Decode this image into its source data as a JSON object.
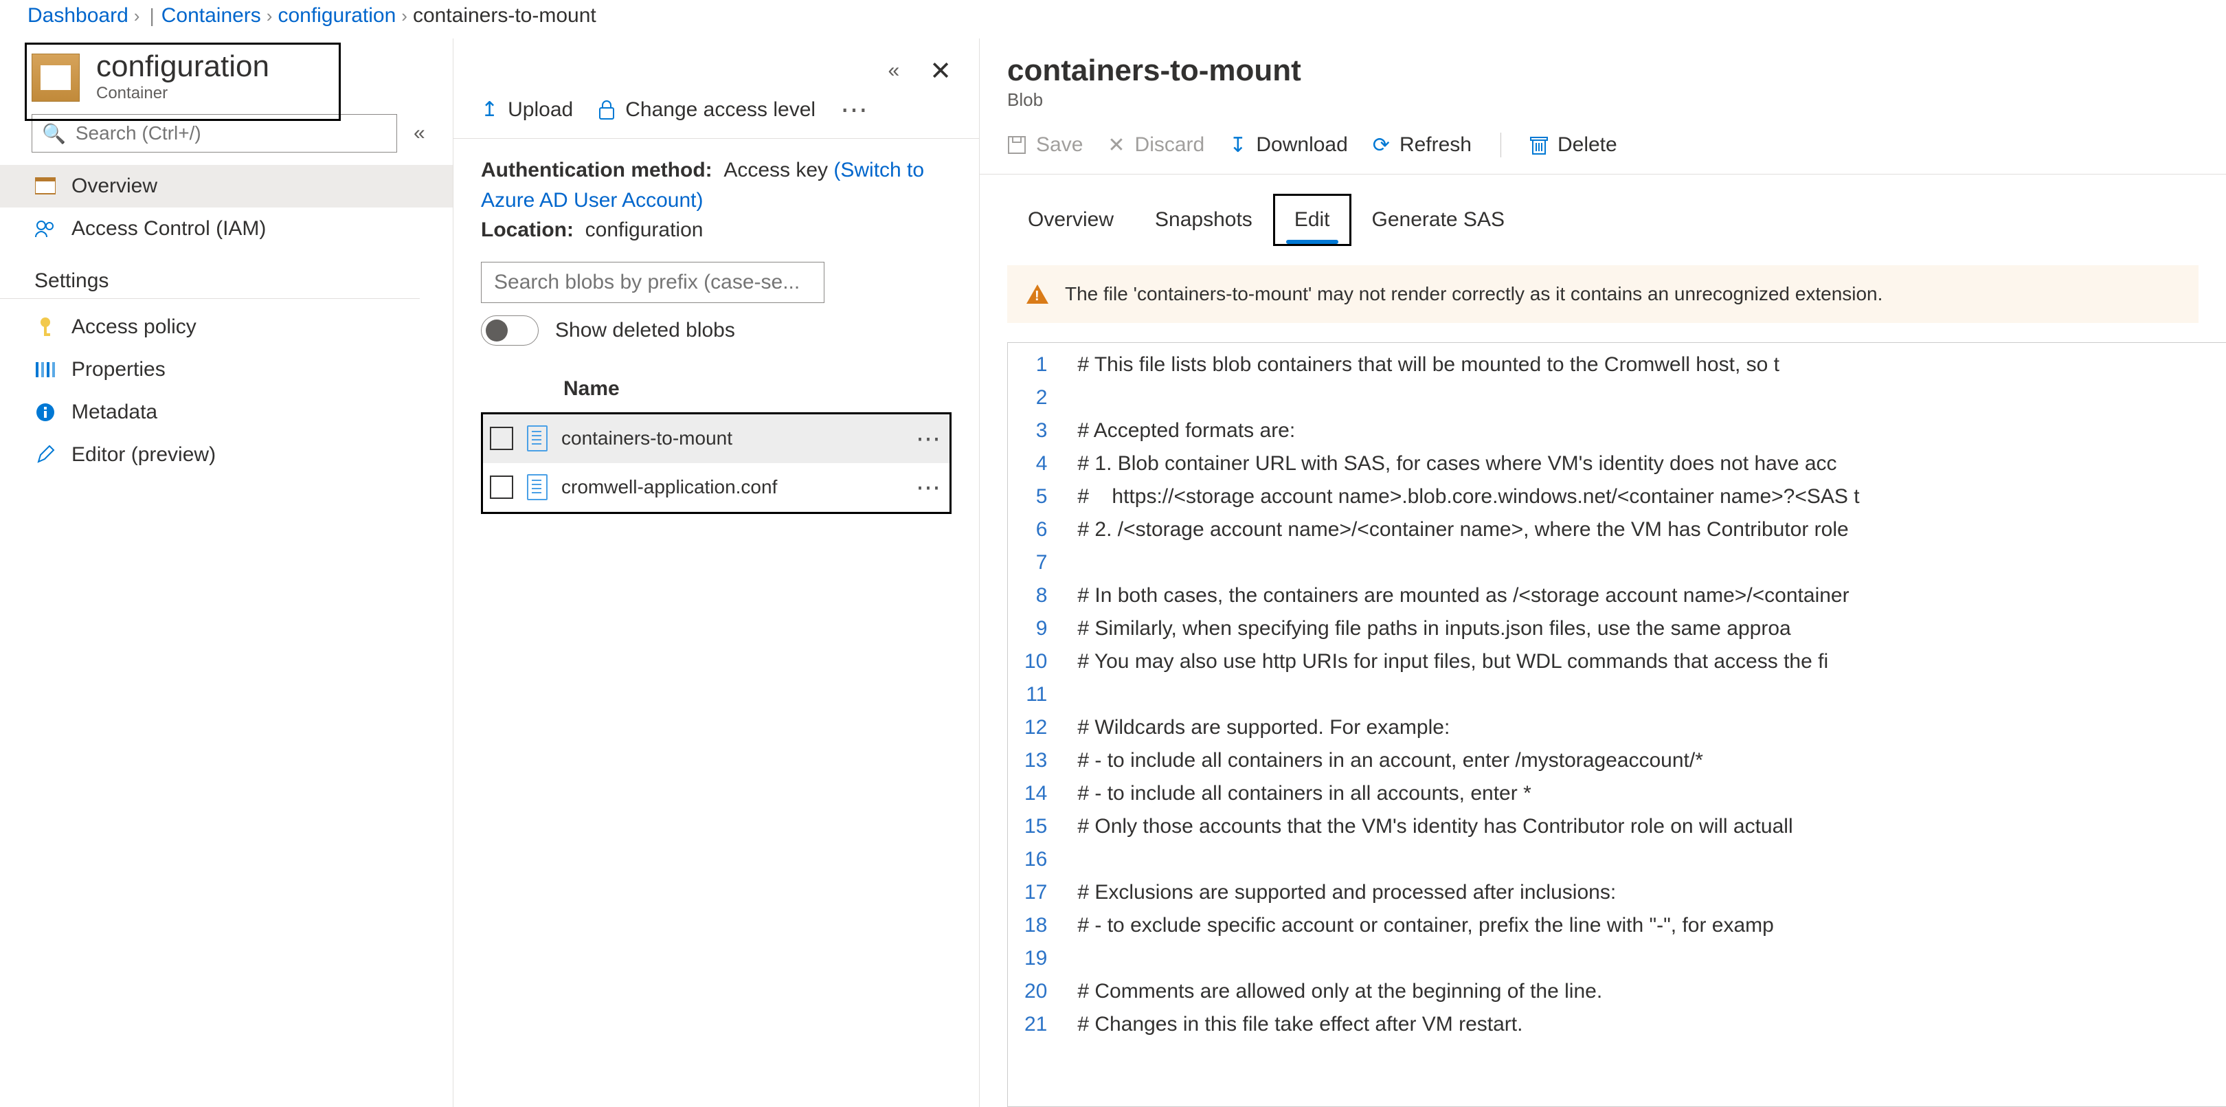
{
  "breadcrumb": {
    "items": [
      "Dashboard",
      "Containers",
      "configuration",
      "containers-to-mount"
    ]
  },
  "left": {
    "title": "configuration",
    "subtitle": "Container",
    "search_placeholder": "Search (Ctrl+/)",
    "nav": {
      "overview": "Overview",
      "access": "Access Control (IAM)",
      "settings_head": "Settings",
      "policy": "Access policy",
      "props": "Properties",
      "meta": "Metadata",
      "editor": "Editor (preview)"
    }
  },
  "mid": {
    "toolbar": {
      "upload": "Upload",
      "change": "Change access level"
    },
    "auth_label": "Authentication method:",
    "auth_value": "Access key",
    "auth_link": "(Switch to Azure AD User Account)",
    "loc_label": "Location:",
    "loc_value": "configuration",
    "blob_search_placeholder": "Search blobs by prefix (case-se...",
    "toggle_label": "Show deleted blobs",
    "th_name": "Name",
    "blobs": [
      {
        "name": "containers-to-mount",
        "selected": true
      },
      {
        "name": "cromwell-application.conf",
        "selected": false
      }
    ]
  },
  "right": {
    "title": "containers-to-mount",
    "subtitle": "Blob",
    "toolbar": {
      "save": "Save",
      "discard": "Discard",
      "download": "Download",
      "refresh": "Refresh",
      "delete": "Delete"
    },
    "tabs": {
      "overview": "Overview",
      "snapshots": "Snapshots",
      "edit": "Edit",
      "sas": "Generate SAS"
    },
    "warning": "The file 'containers-to-mount' may not render correctly as it contains an unrecognized extension.",
    "code_lines": [
      "# This file lists blob containers that will be mounted to the Cromwell host, so t",
      "",
      "# Accepted formats are:",
      "# 1. Blob container URL with SAS, for cases where VM's identity does not have acc",
      "#    https://<storage account name>.blob.core.windows.net/<container name>?<SAS t",
      "# 2. /<storage account name>/<container name>, where the VM has Contributor role ",
      "",
      "# In both cases, the containers are mounted as /<storage account name>/<container",
      "# Similarly, when specifying file paths in inputs.json files, use the same approa",
      "# You may also use http URIs for input files, but WDL commands that access the fi",
      "",
      "# Wildcards are supported. For example:",
      "# - to include all containers in an account, enter /mystorageaccount/*",
      "# - to include all containers in all accounts, enter *",
      "# Only those accounts that the VM's identity has Contributor role on will actuall",
      "",
      "# Exclusions are supported and processed after inclusions:",
      "# - to exclude specific account or container, prefix the line with \"-\", for examp",
      "",
      "# Comments are allowed only at the beginning of the line.",
      "# Changes in this file take effect after VM restart."
    ]
  }
}
